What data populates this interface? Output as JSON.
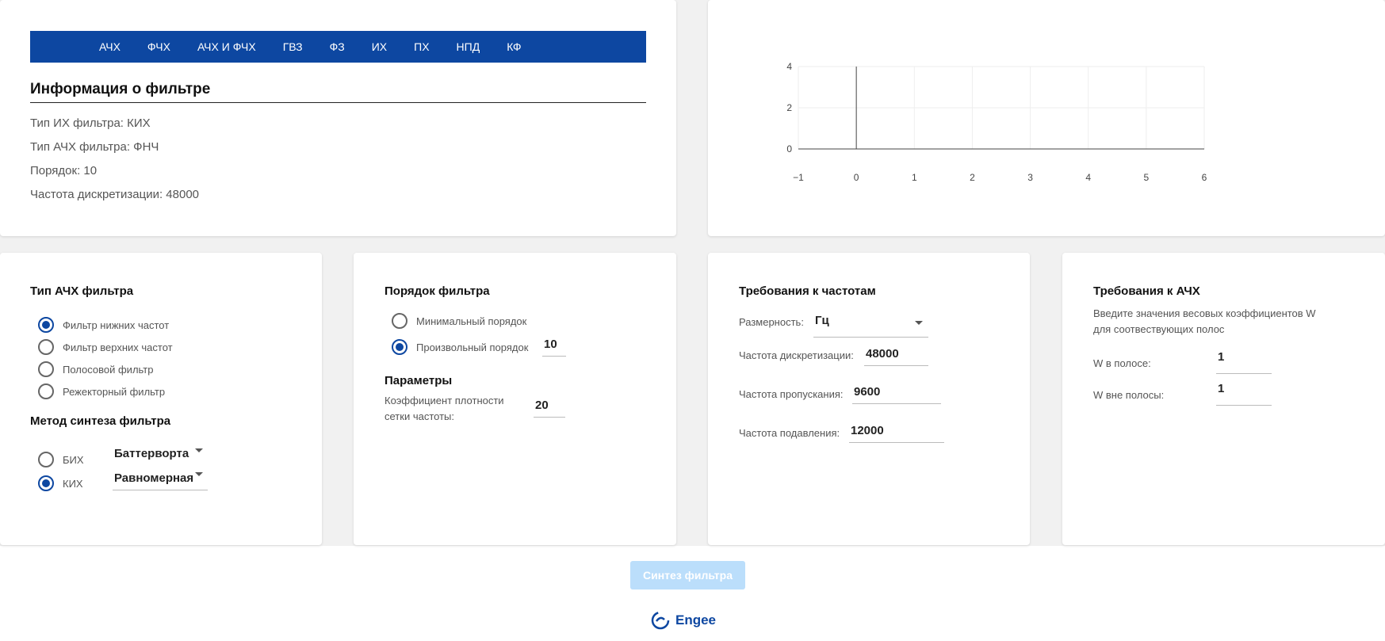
{
  "tabs": [
    "АЧХ",
    "ФЧХ",
    "АЧХ И ФЧХ",
    "ГВЗ",
    "ФЗ",
    "ИХ",
    "ПХ",
    "НПД",
    "КФ"
  ],
  "info": {
    "title": "Информация о фильтре",
    "ir_type": "Тип ИХ фильтра: КИХ",
    "afr_type": "Тип АЧХ фильтра: ФНЧ",
    "order": "Порядок: 10",
    "sample_rate": "Частота дискретизации: 48000"
  },
  "chart_data": {
    "type": "line",
    "series": [],
    "xlim": [
      -1,
      6
    ],
    "ylim": [
      0,
      4
    ],
    "x_ticks": [
      "−1",
      "0",
      "1",
      "2",
      "3",
      "4",
      "5",
      "6"
    ],
    "y_ticks": [
      "4",
      "2",
      "0"
    ],
    "grid": true
  },
  "filter_type": {
    "title": "Тип АЧХ фильтра",
    "options": [
      "Фильтр нижних частот",
      "Фильтр верхних частот",
      "Полосовой фильтр",
      "Режекторный фильтр"
    ],
    "selected": 0
  },
  "synthesis": {
    "title": "Метод синтеза фильтра",
    "iir_label": "БИХ",
    "iir_method": "Баттерворта",
    "fir_label": "КИХ",
    "fir_method": "Равномерная",
    "selected": "КИХ"
  },
  "order": {
    "title": "Порядок фильтра",
    "min_label": "Минимальный порядок",
    "custom_label": "Произвольный порядок",
    "custom_value": "10",
    "params_title": "Параметры",
    "density_label_1": "Коэффициент плотности",
    "density_label_2": "сетки частоты:",
    "density_value": "20"
  },
  "freq": {
    "title": "Требования к частотам",
    "unit_label": "Размерность:",
    "unit_value": "Гц",
    "sample_label": "Частота дискретизации:",
    "sample_value": "48000",
    "pass_label": "Частота пропускания:",
    "pass_value": "9600",
    "stop_label": "Частота подавления:",
    "stop_value": "12000"
  },
  "afr": {
    "title": "Требования к АЧХ",
    "hint_1": "Введите значения весовых коэффициентов W",
    "hint_2": "для соотвествующих полос",
    "w_in_label": "W в полосе:",
    "w_in_value": "1",
    "w_out_label": "W вне полосы:",
    "w_out_value": "1"
  },
  "button": {
    "synthesize": "Синтез фильтра"
  },
  "footer": {
    "brand": "Engee"
  },
  "colors": {
    "primary": "#0d47a1",
    "button_disabled": "#bbdefb",
    "background": "#f1f1f1"
  }
}
